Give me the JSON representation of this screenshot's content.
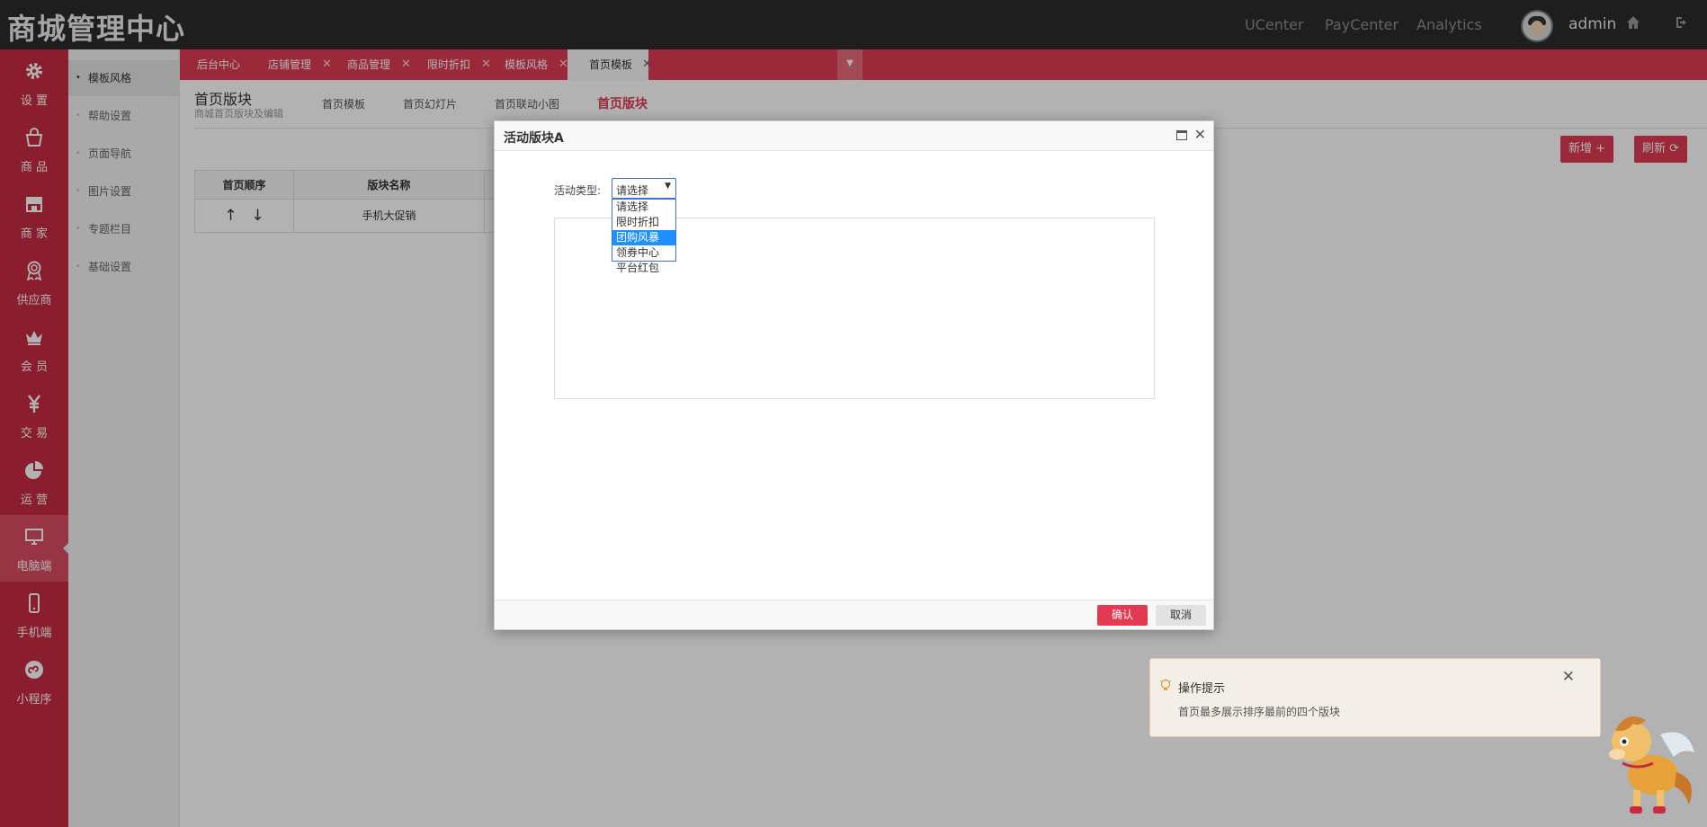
{
  "header": {
    "brand": "商城管理中心",
    "nav": [
      "UCenter",
      "PayCenter",
      "Analytics"
    ],
    "admin_name": "admin"
  },
  "sidebar": {
    "items": [
      {
        "label": "设 置",
        "icon": "gear-icon"
      },
      {
        "label": "商 品",
        "icon": "shopping-bag-icon"
      },
      {
        "label": "商 家",
        "icon": "store-icon"
      },
      {
        "label": "供应商",
        "icon": "award-icon"
      },
      {
        "label": "会 员",
        "icon": "crown-icon"
      },
      {
        "label": "交 易",
        "icon": "yen-icon"
      },
      {
        "label": "运 营",
        "icon": "pie-chart-icon"
      },
      {
        "label": "电脑端",
        "icon": "monitor-icon"
      },
      {
        "label": "手机端",
        "icon": "mobile-icon"
      },
      {
        "label": "小程序",
        "icon": "miniprogram-icon"
      }
    ],
    "active_index": 7
  },
  "submenu": {
    "items": [
      "模板风格",
      "帮助设置",
      "页面导航",
      "图片设置",
      "专题栏目",
      "基础设置"
    ],
    "active_index": 0
  },
  "tabs": {
    "items": [
      "后台中心",
      "店铺管理",
      "商品管理",
      "限时折扣",
      "模板风格",
      "首页模板"
    ],
    "active_index": 5
  },
  "page": {
    "title": "首页版块",
    "subtitle": "商城首页版块及编辑",
    "subtabs": [
      "首页模板",
      "首页幻灯片",
      "首页联动小图",
      "首页版块"
    ],
    "active_subtab": 3,
    "add_button": "新增 +",
    "refresh_button": "刷新 ⟳",
    "table": {
      "headers": [
        "首页顺序",
        "版块名称"
      ],
      "rows": [
        {
          "order_arrows": [
            "↑",
            "↓"
          ],
          "name": "手机大促销"
        }
      ]
    }
  },
  "modal": {
    "title": "活动版块A",
    "field_label": "活动类型:",
    "select_value": "请选择",
    "options": [
      "请选择",
      "限时折扣",
      "团购风暴",
      "领券中心",
      "平台红包"
    ],
    "highlighted_option": 2,
    "ok_button": "确认",
    "cancel_button": "取消"
  },
  "tip": {
    "title": "操作提示",
    "text": "首页最多展示排序最前的四个版块"
  },
  "colors": {
    "accent": "#e03b52",
    "sidebar": "#c72b42",
    "topbar": "#2b2b2b"
  }
}
